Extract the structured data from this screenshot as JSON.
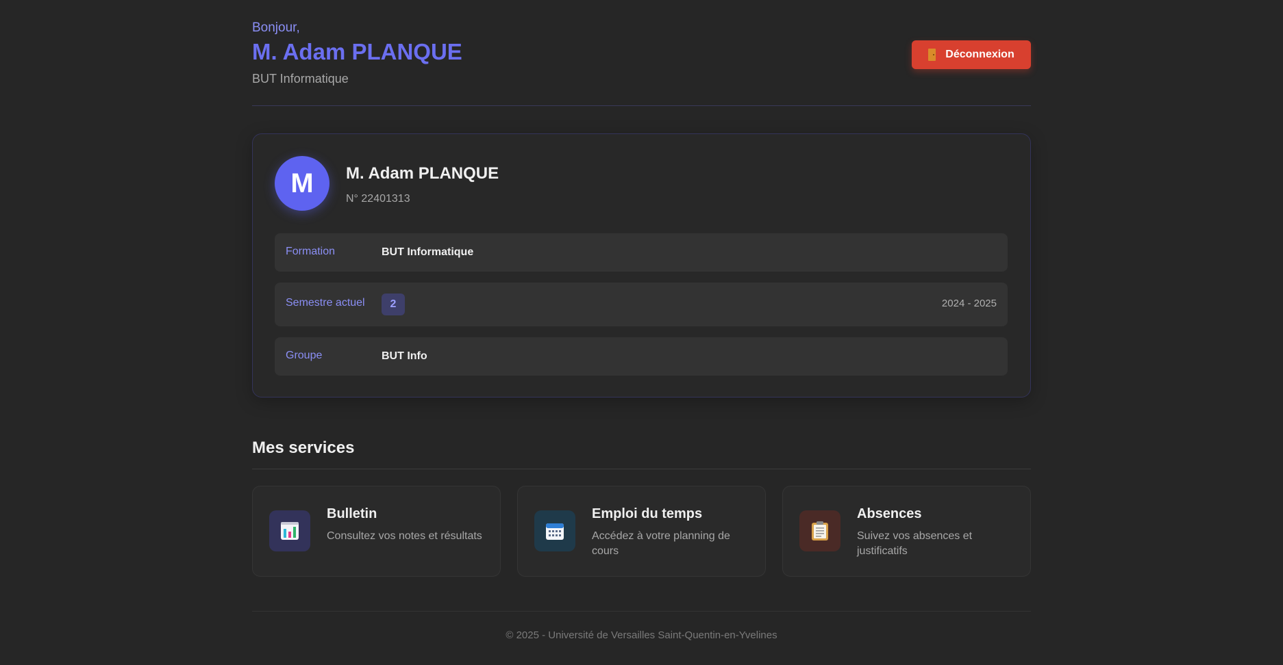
{
  "header": {
    "greeting": "Bonjour,",
    "user_name": "M. Adam PLANQUE",
    "formation": "BUT Informatique",
    "logout_label": "Déconnexion",
    "logout_icon": "door-icon"
  },
  "profile": {
    "avatar_initial": "M",
    "name": "M. Adam PLANQUE",
    "student_number": "N° 22401313",
    "rows": [
      {
        "label": "Formation",
        "value": "BUT Informatique"
      },
      {
        "label": "Semestre actuel",
        "value": "2",
        "year": "2024 - 2025"
      },
      {
        "label": "Groupe",
        "value": "BUT Info"
      }
    ]
  },
  "services": {
    "title": "Mes services",
    "items": [
      {
        "title": "Bulletin",
        "description": "Consultez vos notes et résultats",
        "icon": "bar-chart-icon"
      },
      {
        "title": "Emploi du temps",
        "description": "Accédez à votre planning de cours",
        "icon": "calendar-icon"
      },
      {
        "title": "Absences",
        "description": "Suivez vos absences et justificatifs",
        "icon": "clipboard-icon"
      }
    ]
  },
  "footer": {
    "text": "© 2025 - Université de Versailles Saint-Quentin-en-Yvelines"
  },
  "colors": {
    "accent": "#6b6ff0",
    "danger": "#d8402f",
    "background": "#262626"
  }
}
